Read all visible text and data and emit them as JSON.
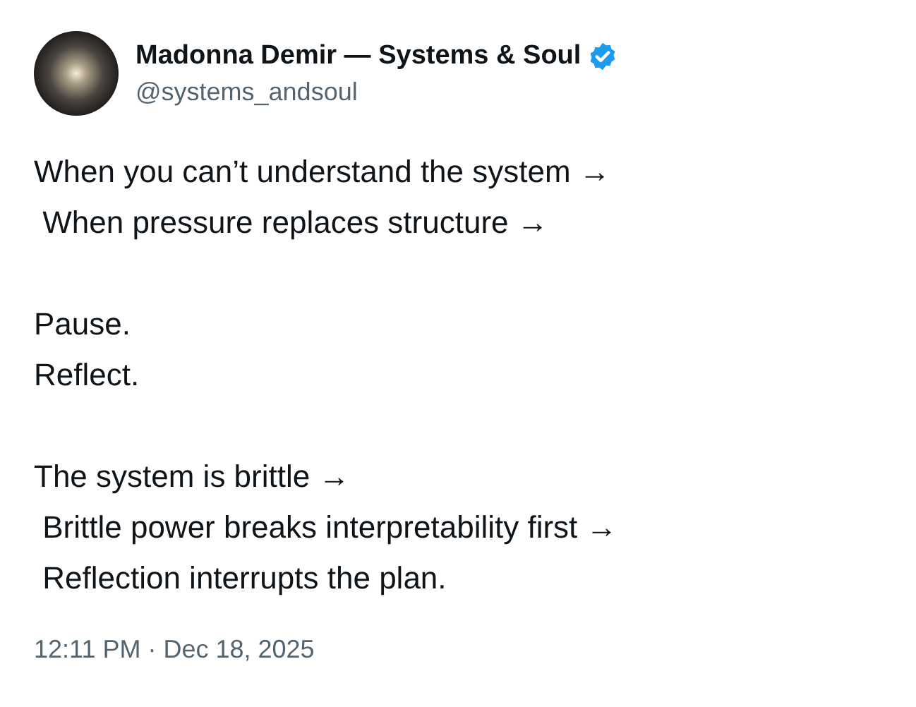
{
  "author": {
    "name": "Madonna Demir — Systems & Soul",
    "verified": true,
    "handle": "@systems_andsoul"
  },
  "paragraphs": [
    [
      "When you can’t understand the system →",
      " When pressure replaces structure →"
    ],
    [
      "Pause.",
      "Reflect."
    ],
    [
      "The system is brittle →",
      " Brittle power breaks interpretability first →",
      " Reflection interrupts the plan."
    ]
  ],
  "timestamp": "12:11 PM · Dec 18, 2025"
}
